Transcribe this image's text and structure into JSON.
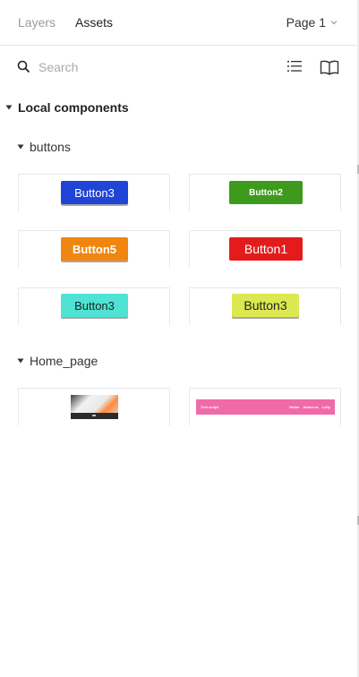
{
  "header": {
    "tabs": [
      {
        "label": "Layers",
        "active": false
      },
      {
        "label": "Assets",
        "active": true
      }
    ],
    "page_selector": "Page 1"
  },
  "search": {
    "placeholder": "Search",
    "value": ""
  },
  "toolbar_icons": [
    "list-view-icon",
    "library-icon"
  ],
  "local_components": {
    "label": "Local components",
    "groups": [
      {
        "label": "buttons",
        "items": [
          {
            "label": "Button3",
            "bg": "#1f44d6",
            "fg": "#ffffff"
          },
          {
            "label": "Button2",
            "bg": "#3d9a1c",
            "fg": "#ffffff"
          },
          {
            "label": "Button5",
            "bg": "#f0860f",
            "fg": "#ffffff"
          },
          {
            "label": "Button1",
            "bg": "#e31b1b",
            "fg": "#ffffff"
          },
          {
            "label": "Button3",
            "bg": "#4ee3d4",
            "fg": "#222222"
          },
          {
            "label": "Button3",
            "bg": "#dbe84f",
            "fg": "#222222"
          }
        ]
      },
      {
        "label": "Home_page",
        "items": [
          {
            "kind": "image-thumbnail"
          },
          {
            "kind": "navbar",
            "brand": "Test script",
            "links": [
              "Home",
              "About us",
              "Lolly"
            ],
            "bg": "#f06aa8"
          }
        ]
      }
    ]
  },
  "colors": {
    "accent_text": "#222222",
    "muted_text": "#9b9b9b",
    "border": "#e8e8e8"
  }
}
